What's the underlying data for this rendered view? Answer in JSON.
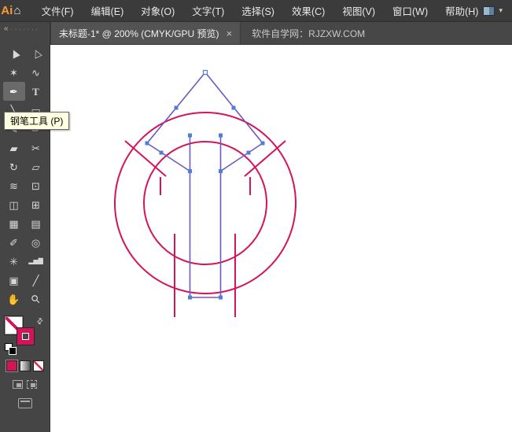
{
  "menubar": {
    "logo": "Ai",
    "items": [
      "文件(F)",
      "编辑(E)",
      "对象(O)",
      "文字(T)",
      "选择(S)",
      "效果(C)",
      "视图(V)",
      "窗口(W)",
      "帮助(H)"
    ]
  },
  "tabbar": {
    "tab_title": "未标题-1* @ 200% (CMYK/GPU 预览)",
    "close": "×",
    "right_text": "软件自学网：RJZXW.COM"
  },
  "toolbar": {
    "tooltip": "钢笔工具 (P)",
    "selected_tool": "pen-tool",
    "tools": [
      {
        "name": "selection-tool",
        "glyph": "▶"
      },
      {
        "name": "direct-selection-tool",
        "glyph": "▷"
      },
      {
        "name": "magic-wand-tool",
        "glyph": "✶"
      },
      {
        "name": "lasso-tool",
        "glyph": "∿"
      },
      {
        "name": "pen-tool",
        "glyph": "✒"
      },
      {
        "name": "type-tool",
        "glyph": "T"
      },
      {
        "name": "line-segment-tool",
        "glyph": "╲"
      },
      {
        "name": "rectangle-tool",
        "glyph": "▭"
      },
      {
        "name": "paintbrush-tool",
        "glyph": "✎"
      },
      {
        "name": "pencil-tool",
        "glyph": "✏"
      },
      {
        "name": "eraser-tool",
        "glyph": "▰"
      },
      {
        "name": "scissors-tool",
        "glyph": "✂"
      },
      {
        "name": "rotate-tool",
        "glyph": "↻"
      },
      {
        "name": "scale-tool",
        "glyph": "▱"
      },
      {
        "name": "width-tool",
        "glyph": "≋"
      },
      {
        "name": "free-transform-tool",
        "glyph": "⊡"
      },
      {
        "name": "shape-builder-tool",
        "glyph": "◫"
      },
      {
        "name": "perspective-grid-tool",
        "glyph": "⊞"
      },
      {
        "name": "mesh-tool",
        "glyph": "▦"
      },
      {
        "name": "gradient-tool",
        "glyph": "▤"
      },
      {
        "name": "eyedropper-tool",
        "glyph": "✐"
      },
      {
        "name": "blend-tool",
        "glyph": "◎"
      },
      {
        "name": "symbol-sprayer-tool",
        "glyph": "✳"
      },
      {
        "name": "column-graph-tool",
        "glyph": "▂▅▇"
      },
      {
        "name": "artboard-tool",
        "glyph": "▣"
      },
      {
        "name": "slice-tool",
        "glyph": "╱"
      },
      {
        "name": "hand-tool",
        "glyph": "✋"
      },
      {
        "name": "zoom-tool",
        "glyph": "⚲"
      }
    ]
  },
  "icons": {
    "home": "⌂",
    "chevron": "▾",
    "swap": "⇄",
    "collapse": "«",
    "grip": "·······"
  },
  "colors": {
    "crimson": "#d4145a",
    "purple": "#6e58c2",
    "anchor": "#4d7fd9",
    "logo_amber": "#ff9a33"
  }
}
